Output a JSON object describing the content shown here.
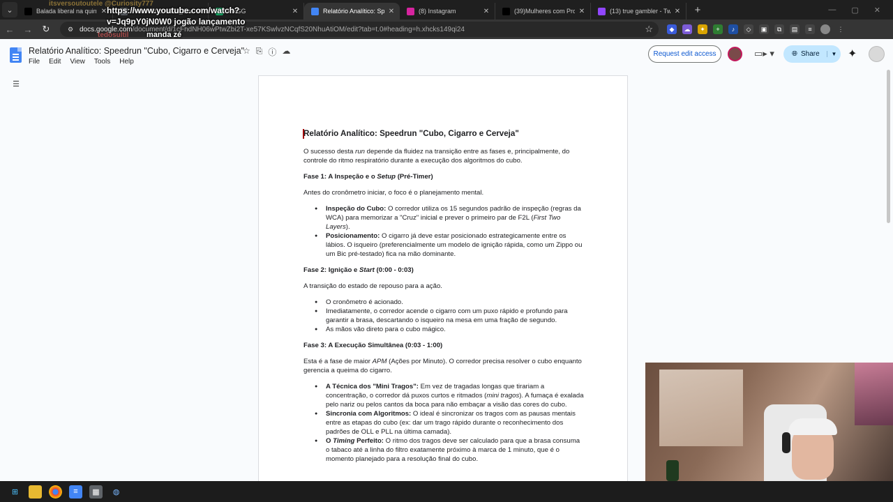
{
  "browser": {
    "tabs": [
      {
        "label": "Balada liberal na quinta-f",
        "icon": "tiktok-icon",
        "color": "#000000",
        "active": false
      },
      {
        "label": "Watch 20260329_Correct",
        "icon": "globe-icon",
        "color": "#5f6368",
        "active": false
      },
      {
        "label": "PixGG",
        "icon": "pixgg-icon",
        "color": "#18b36b",
        "active": false
      },
      {
        "label": "Relatório Analítico: Speed",
        "icon": "docs-icon",
        "color": "#4285f4",
        "active": true
      },
      {
        "label": "(8) Instagram",
        "icon": "instagram-icon",
        "color": "#d6249f",
        "active": false
      },
      {
        "label": "(39)Mulheres com Proble",
        "icon": "tiktok-icon",
        "color": "#000000",
        "active": false
      },
      {
        "label": "(13) true gambler - Twitch",
        "icon": "twitch-icon",
        "color": "#9146ff",
        "active": false
      }
    ],
    "address": {
      "domain": "docs.google.com",
      "path": "/document/d/1cFhdNH06wPtwZbi2T-xe57KSwlvzNCqfS20NhuAtiOM/edit?tab=t.0#heading=h.xhcks149qi24"
    }
  },
  "stream_overlay": {
    "top_text": "itsversoutoutele  @Curiosity777",
    "url_line1": "https://www.youtube.com/watch?",
    "url_line2": "v=Jq9pY0jN0W0 jogão lançamento",
    "user": "tedosultil",
    "command": "manda zé"
  },
  "docs": {
    "title": "Relatório Analítico: Speedrun \"Cubo, Cigarro e Cerveja\"",
    "menus": [
      "File",
      "Edit",
      "View",
      "Tools",
      "Help"
    ],
    "request_edit_label": "Request edit access",
    "share_label": "Share"
  },
  "document": {
    "heading": "Relatório Analítico: Speedrun \"Cubo, Cigarro e Cerveja\"",
    "intro": "O sucesso desta run depende da fluidez na transição entre as fases e, principalmente, do controle do ritmo respiratório durante a execução dos algoritmos do cubo.",
    "phase1_title": "Fase 1: A Inspeção e o Setup (Pré-Timer)",
    "phase1_intro": "Antes do cronômetro iniciar, o foco é o planejamento mental.",
    "phase1_items": [
      {
        "bold": "Inspeção do Cubo:",
        "text": " O corredor utiliza os 15 segundos padrão de inspeção (regras da WCA) para memorizar a \"Cruz\" inicial e prever o primeiro par de F2L (First Two Layers)."
      },
      {
        "bold": "Posicionamento:",
        "text": " O cigarro já deve estar posicionado estrategicamente entre os lábios. O isqueiro (preferencialmente um modelo de ignição rápida, como um Zippo ou um Bic pré-testado) fica na mão dominante."
      }
    ],
    "phase2_title": "Fase 2: Ignição e Start (0:00 - 0:03)",
    "phase2_intro": "A transição do estado de repouso para a ação.",
    "phase2_items": [
      {
        "bold": "",
        "text": "O cronômetro é acionado."
      },
      {
        "bold": "",
        "text": "Imediatamente, o corredor acende o cigarro com um puxo rápido e profundo para garantir a brasa, descartando o isqueiro na mesa em uma fração de segundo."
      },
      {
        "bold": "",
        "text": "As mãos vão direto para o cubo mágico."
      }
    ],
    "phase3_title": "Fase 3: A Execução Simultânea (0:03 - 1:00)",
    "phase3_intro": "Esta é a fase de maior APM (Ações por Minuto). O corredor precisa resolver o cubo enquanto gerencia a queima do cigarro.",
    "phase3_items": [
      {
        "bold": "A Técnica dos \"Mini Tragos\":",
        "text": " Em vez de tragadas longas que tirariam a concentração, o corredor dá puxos curtos e ritmados (mini tragos). A fumaça é exalada pelo nariz ou pelos cantos da boca para não embaçar a visão das cores do cubo."
      },
      {
        "bold": "Sincronia com Algoritmos:",
        "text": " O ideal é sincronizar os tragos com as pausas mentais entre as etapas do cubo (ex: dar um trago rápido durante o reconhecimento dos padrões de OLL e PLL na última camada)."
      },
      {
        "bold": "O Timing Perfeito:",
        "text": " O ritmo dos tragos deve ser calculado para que a brasa consuma o tabaco até a linha do filtro exatamente próximo à marca de 1 minuto, que é o momento planejado para a resolução final do cubo."
      }
    ]
  },
  "colors": {
    "accent": "#0b57d0",
    "share_bg": "#c2e7ff",
    "tab_bar": "#1f1f1f"
  }
}
